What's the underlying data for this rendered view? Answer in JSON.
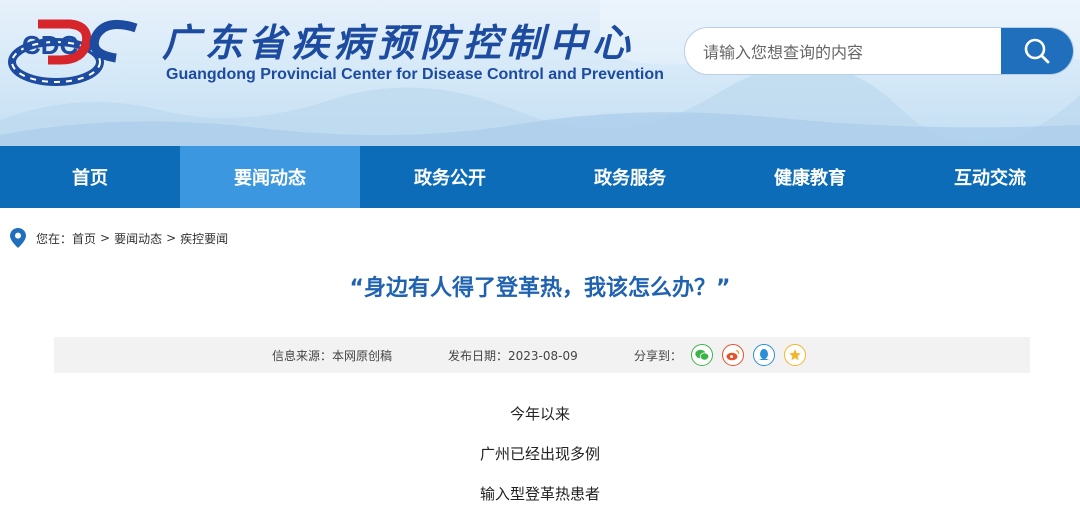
{
  "header": {
    "logo_mark": "CDC",
    "logo_name_cn": "广东省疾病预防控制中心",
    "logo_name_en": "Guangdong Provincial Center for Disease Control and Prevention",
    "search": {
      "placeholder": "请输入您想查询的内容"
    }
  },
  "nav": {
    "items": [
      {
        "label": "首页"
      },
      {
        "label": "要闻动态",
        "active": true
      },
      {
        "label": "政务公开"
      },
      {
        "label": "政务服务"
      },
      {
        "label": "健康教育"
      },
      {
        "label": "互动交流"
      }
    ]
  },
  "breadcrumb": {
    "prefix": "您在：",
    "items": [
      "首页",
      "要闻动态",
      "疾控要闻"
    ],
    "separator": ">"
  },
  "article": {
    "title": "“身边有人得了登革热，我该怎么办？”",
    "meta": {
      "source": "信息来源：本网原创稿",
      "date": "发布日期：2023-08-09",
      "share_label": "分享到："
    },
    "share_icons": [
      {
        "name": "wechat-icon",
        "color": "#3bb34a"
      },
      {
        "name": "weibo-icon",
        "color": "#e6502b"
      },
      {
        "name": "qq-icon",
        "color": "#2a8fd6"
      },
      {
        "name": "favorite-star-icon",
        "color": "#f3b52c"
      }
    ],
    "paragraphs": [
      "今年以来",
      "广州已经出现多例",
      "输入型登革热患者"
    ]
  },
  "colors": {
    "nav_bg": "#0d6cb8",
    "nav_active": "#3b97e0",
    "title": "#1f62b0",
    "logo_blue": "#1c4ba0",
    "logo_red": "#d7252c"
  }
}
